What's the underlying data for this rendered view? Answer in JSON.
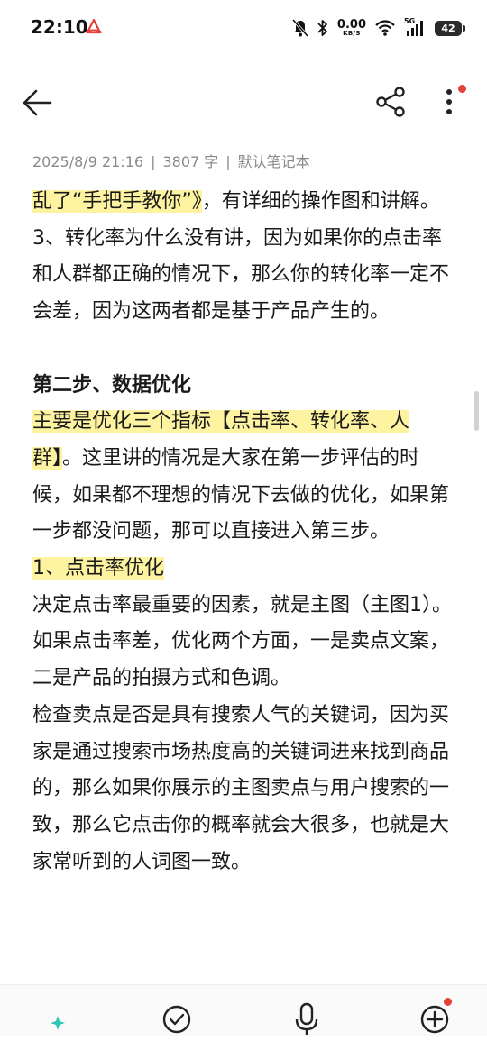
{
  "status_bar": {
    "time": "22:10",
    "net_speed_value": "0.00",
    "net_speed_unit": "KB/S",
    "network_type": "5G",
    "battery": "42",
    "icons": [
      "app-logo-icon",
      "mute-bell-icon",
      "bluetooth-icon",
      "wifi-icon",
      "cellular-signal-icon",
      "battery-icon"
    ]
  },
  "toolbar": {
    "icons": [
      "back-arrow-icon",
      "share-icon",
      "more-vertical-icon"
    ],
    "notification_dot_color": "#e5413a"
  },
  "meta": {
    "date": "2025/8/9 21:16",
    "separator": "|",
    "word_count": "3807 字",
    "notebook": "默认笔记本"
  },
  "note": {
    "p1_highlight": "乱了“手把手教你”》",
    "p1_rest": "，有详细的操作图和讲解。",
    "p2": "3、转化率为什么没有讲，因为如果你的点击率和人群都正确的情况下，那么你的转化率一定不会差，因为这两者都是基于产品产生的。",
    "heading2": "第二步、数据优化",
    "p3_highlight": "主要是优化三个指标【点击率、转化率、人群】",
    "p3_rest": "。这里讲的情况是大家在第一步评估的时候，如果都不理想的情况下去做的优化，如果第一步都没问题，那可以直接进入第三步。",
    "sub1": "1、点击率优化",
    "p4": "决定点击率最重要的因素，就是主图（主图1）。如果点击率差，优化两个方面，一是卖点文案，二是产品的拍摄方式和色调。",
    "p5": "检查卖点是否是具有搜索人气的关键词，因为买家是通过搜索市场热度高的关键词进来找到商品的，那么如果你展示的主图卖点与用户搜索的一致，那么它点击你的概率就会大很多，也就是大家常听到的人词图一致。"
  },
  "bottom_bar": {
    "icons": [
      "ai-sparkle-list-icon",
      "checkmark-circle-icon",
      "microphone-icon",
      "add-circle-icon"
    ]
  },
  "colors": {
    "highlight": "#fdf3a0",
    "meta_text": "#8a8a8a",
    "accent_red": "#e5413a"
  }
}
